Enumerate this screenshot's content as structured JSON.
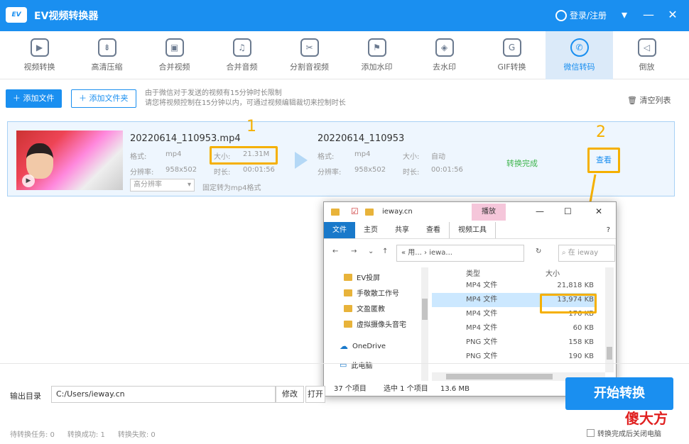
{
  "app": {
    "title": "EV视频转换器",
    "logo": "EV",
    "user_label": "登录/注册"
  },
  "toolbar": [
    {
      "label": "视频转换",
      "icon": "▶"
    },
    {
      "label": "高清压缩",
      "icon": "⇟"
    },
    {
      "label": "合并视频",
      "icon": "▣"
    },
    {
      "label": "合并音频",
      "icon": "♫"
    },
    {
      "label": "分割音视频",
      "icon": "✂"
    },
    {
      "label": "添加水印",
      "icon": "⚑"
    },
    {
      "label": "去水印",
      "icon": "◈"
    },
    {
      "label": "GIF转换",
      "icon": "G"
    },
    {
      "label": "微信转码",
      "icon": "✆"
    },
    {
      "label": "倒放",
      "icon": "◁"
    }
  ],
  "actions": {
    "add_file": "添加文件",
    "add_folder": "添加文件夹",
    "hint_line1": "由于微信对于发送的视频有15分钟时长限制",
    "hint_line2": "请您将视频控制在15分钟以内，可通过视频编辑裁切来控制时长",
    "clear_list": "清空列表"
  },
  "task": {
    "source_name": "20220614_110953.mp4",
    "source_format_label": "格式:",
    "source_format": "mp4",
    "source_size_label": "大小:",
    "source_size": "21.31M",
    "source_res_label": "分辨率:",
    "source_res": "958x502",
    "source_dur_label": "时长:",
    "source_dur": "00:01:56",
    "quality": "高分辨率",
    "fixed_note": "固定转为mp4格式",
    "target_name": "20220614_110953",
    "target_format_label": "格式:",
    "target_format": "mp4",
    "target_size_label": "大小:",
    "target_size": "自动",
    "target_res_label": "分辨率:",
    "target_res": "958x502",
    "target_dur_label": "时长:",
    "target_dur": "00:01:56",
    "status": "转换完成",
    "view": "查看",
    "marker1": "1",
    "marker2": "2"
  },
  "explorer": {
    "path_title": "ieway.cn",
    "manage_tab": "播放",
    "ribbon": [
      "文件",
      "主页",
      "共享",
      "查看",
      "视频工具"
    ],
    "address": "« 用... › iewa...",
    "search": "在 ieway",
    "nav": [
      {
        "label": "EV投屏",
        "icon": "folder"
      },
      {
        "label": "手敬散工作号",
        "icon": "folder"
      },
      {
        "label": "文盈匿教",
        "icon": "folder"
      },
      {
        "label": "虚拟摄像头音宅",
        "icon": "folder"
      },
      {
        "label": "OneDrive",
        "icon": "cloud"
      },
      {
        "label": "此电脑",
        "icon": "pc"
      }
    ],
    "headers": {
      "type": "类型",
      "size": "大小"
    },
    "files": [
      {
        "type": "MP4 文件",
        "size": "21,818 KB"
      },
      {
        "type": "MP4 文件",
        "size": "13,974 KB",
        "selected": true
      },
      {
        "type": "MP4 文件",
        "size": "176 KB"
      },
      {
        "type": "MP4 文件",
        "size": "60 KB"
      },
      {
        "type": "PNG 文件",
        "size": "158 KB"
      },
      {
        "type": "PNG 文件",
        "size": "190 KB"
      }
    ],
    "status": {
      "count": "37 个项目",
      "selected": "选中 1 个项目",
      "size": "13.6 MB"
    }
  },
  "bottom": {
    "output_label": "输出目录",
    "output_path": "C:/Users/ieway.cn",
    "modify": "修改",
    "open": "打开",
    "start": "开始转换",
    "stats": [
      "待转换任务: 0",
      "转换成功: 1",
      "转换失败: 0"
    ],
    "auto_close": "转换完成后关闭电脑"
  },
  "watermark": "傻大方",
  "colors": {
    "accent": "#1a8ff0",
    "highlight": "#f5b000",
    "success": "#3cb44b"
  }
}
